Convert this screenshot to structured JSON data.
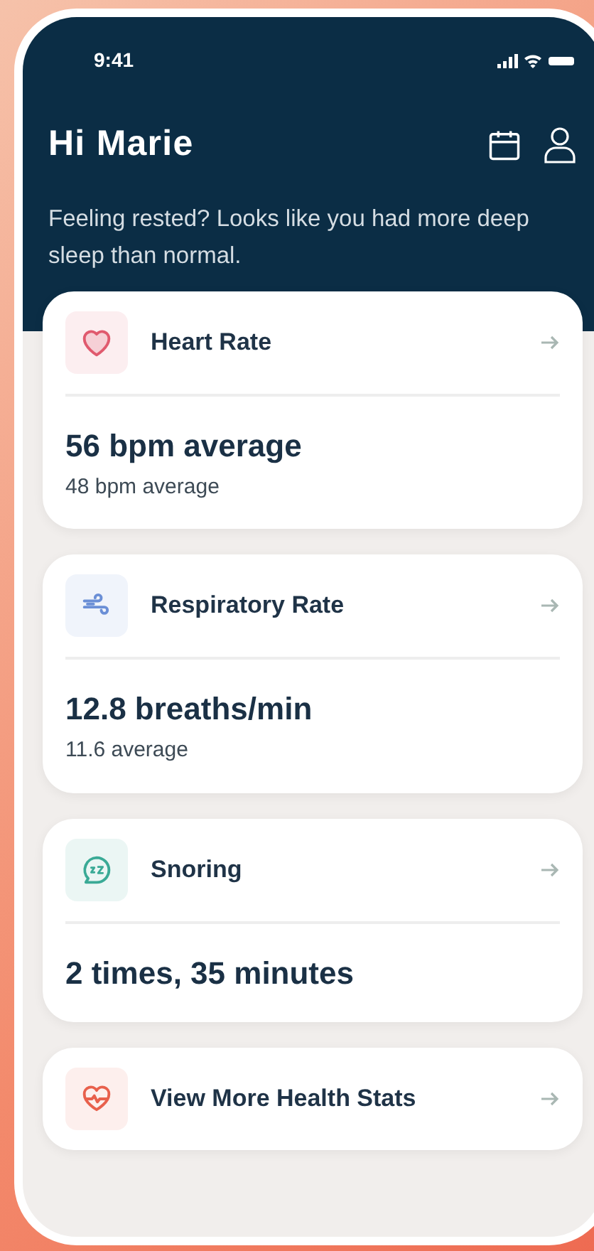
{
  "status_bar": {
    "time": "9:41"
  },
  "header": {
    "greeting": "Hi Marie",
    "message": "Feeling rested? Looks like you had more deep sleep than normal."
  },
  "cards": [
    {
      "kind": "metric",
      "title": "Heart Rate",
      "color": "#e05a6e",
      "value": "56 bpm average",
      "sub": "48 bpm average"
    },
    {
      "kind": "metric",
      "title": "Respiratory Rate",
      "color": "#6b8fd6",
      "value": "12.8 breaths/min",
      "sub": "11.6 average"
    },
    {
      "kind": "metric",
      "title": "Snoring",
      "color": "#3aaa96",
      "value": "2 times, 35 minutes"
    },
    {
      "kind": "link",
      "title": "View More Health Stats",
      "color": "#e8604c"
    }
  ]
}
